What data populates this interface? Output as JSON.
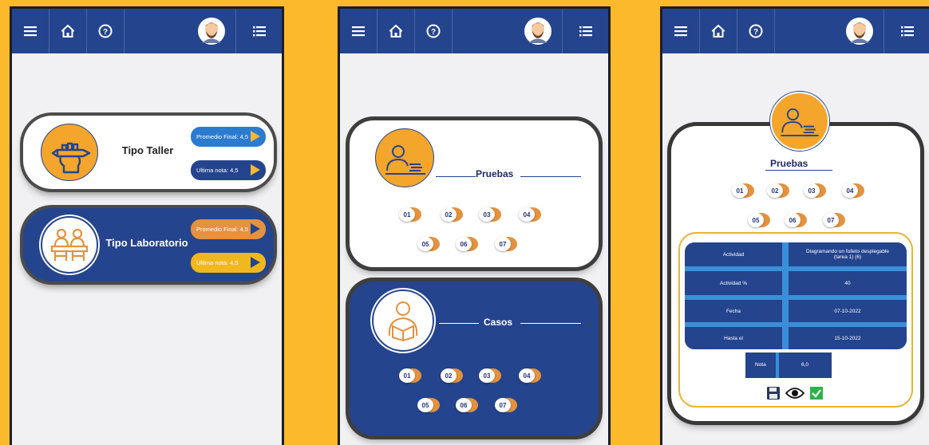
{
  "colors": {
    "background": "#fbb92b",
    "navy": "#25448e",
    "orange": "#e4923f",
    "gold": "#f0b81f",
    "table_accent": "#3b8fd8"
  },
  "appbar": {
    "icons": [
      "menu-icon",
      "home-icon",
      "help-icon",
      "avatar",
      "list-icon"
    ]
  },
  "screen1": {
    "cards": [
      {
        "title": "Tipo Taller",
        "icon": "hand-with-pencil-icon",
        "promedio": "Promedio Final: 4,5",
        "ultima": "Ultima nota: 4,5"
      },
      {
        "title": "Tipo Laboratorio",
        "icon": "students-at-desks-icon",
        "promedio": "Promedio Final: 4,5",
        "ultima": "Ultima nota: 4,5"
      }
    ]
  },
  "screen2": {
    "pruebas": {
      "title": "Pruebas",
      "items": [
        "01",
        "02",
        "03",
        "04",
        "05",
        "06",
        "07"
      ]
    },
    "casos": {
      "title": "Casos",
      "items": [
        "01",
        "02",
        "03",
        "04",
        "05",
        "06",
        "07"
      ]
    }
  },
  "screen3": {
    "title": "Pruebas",
    "items": [
      "01",
      "02",
      "03",
      "04",
      "05",
      "06",
      "07"
    ],
    "table": {
      "rows": [
        {
          "label": "Actividad",
          "value": "Diagramando un folleto desplegable (tarea 1) (6)"
        },
        {
          "label": "Actividad %",
          "value": "40"
        },
        {
          "label": "Fecha",
          "value": "07-10-2022"
        },
        {
          "label": "Hasta el",
          "value": "15-10-2022"
        }
      ],
      "nota_label": "Nota",
      "nota_value": "6,0"
    },
    "actions": [
      "save-icon",
      "eye-icon",
      "check-icon"
    ]
  }
}
